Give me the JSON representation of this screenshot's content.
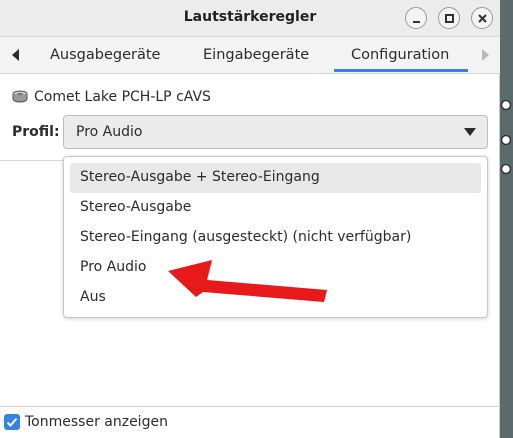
{
  "window": {
    "title": "Lautstärkeregler"
  },
  "tabs": [
    {
      "label": "Ausgabegeräte"
    },
    {
      "label": "Eingabegeräte"
    },
    {
      "label": "Configuration",
      "active": true
    }
  ],
  "device": {
    "name": "Comet Lake PCH-LP cAVS",
    "icon": "sound-card-icon"
  },
  "profile": {
    "label": "Profil:",
    "selected": "Pro Audio",
    "options": [
      "Stereo-Ausgabe + Stereo-Eingang",
      "Stereo-Ausgabe",
      "Stereo-Eingang (ausgesteckt) (nicht verfügbar)",
      "Pro Audio",
      "Aus"
    ],
    "highlighted_option": "Stereo-Ausgabe + Stereo-Eingang"
  },
  "footer": {
    "checkbox_label": "Tonmesser anzeigen",
    "checked": true
  },
  "colors": {
    "accent": "#3584e4",
    "annotation_arrow": "#e8191b"
  }
}
